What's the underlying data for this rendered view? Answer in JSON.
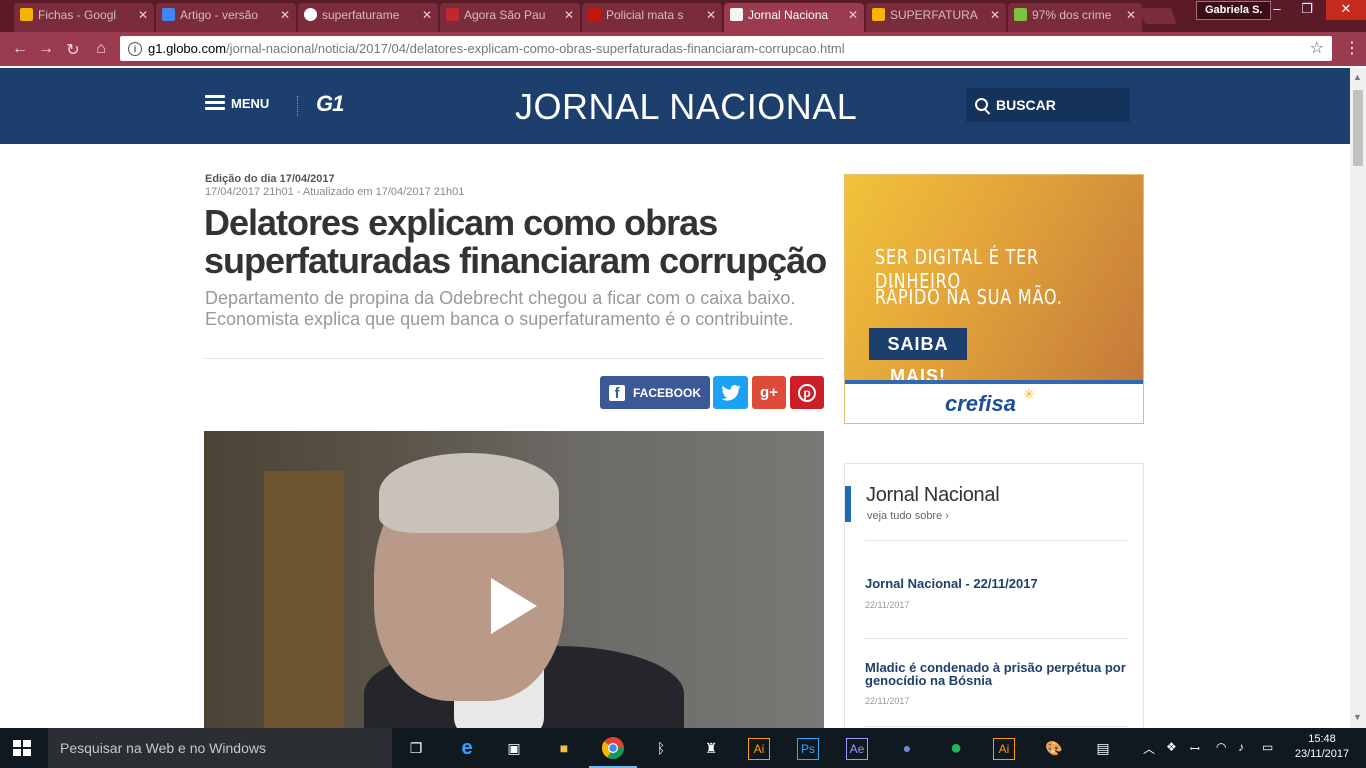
{
  "browser": {
    "tabs": [
      {
        "title": "Fichas - Googl",
        "favicon_color": "#f4b400"
      },
      {
        "title": "Artigo - versão",
        "favicon_color": "#4285f4"
      },
      {
        "title": "superfaturame",
        "favicon_color": "#ffffff"
      },
      {
        "title": "Agora São Pau",
        "favicon_color": "#c0282d"
      },
      {
        "title": "Policial mata s",
        "favicon_color": "#c4170c"
      },
      {
        "title": "Jornal Naciona",
        "favicon_color": "#f5f5f5"
      },
      {
        "title": "SUPERFATURA",
        "favicon_color": "#f4b400"
      },
      {
        "title": "97% dos crime",
        "favicon_color": "#7cc242"
      }
    ],
    "user": "Gabriela S.",
    "url_host": "g1.globo.com",
    "url_path": "/jornal-nacional/noticia/2017/04/delatores-explicam-como-obras-superfaturadas-financiaram-corrupcao.html"
  },
  "site": {
    "menu_label": "MENU",
    "logo": "G1",
    "title": "JORNAL NACIONAL",
    "search_label": "BUSCAR",
    "brand_color": "#1d3f6e"
  },
  "article": {
    "edition_prefix": "Edição do dia",
    "edition_date": "17/04/2017",
    "dates": "17/04/2017 21h01 - Atualizado em 17/04/2017 21h01",
    "headline": "Delatores explicam como obras superfaturadas financiaram corrupção",
    "subhead": "Departamento de propina da Odebrecht chegou a ficar com o caixa baixo. Economista explica que quem banca o superfaturamento é o contribuinte.",
    "share": {
      "facebook": "FACEBOOK",
      "twitter_icon": "twitter-icon",
      "gplus": "g+",
      "pinterest_icon": "pinterest-icon"
    }
  },
  "ad": {
    "line1": "SER DIGITAL É TER DINHEIRO",
    "line2": "RÁPIDO NA SUA MÃO.",
    "button": "SAIBA MAIS!",
    "brand": "crefisa"
  },
  "widget": {
    "title": "Jornal Nacional",
    "more": "veja tudo sobre ›",
    "items": [
      {
        "title": "Jornal Nacional - 22/11/2017",
        "date": "22/11/2017"
      },
      {
        "title": "Mladic é condenado à prisão perpétua por genocídio na Bósnia",
        "date": "22/11/2017"
      }
    ]
  },
  "taskbar": {
    "search_placeholder": "Pesquisar na Web e no Windows",
    "time": "15:48",
    "date": "23/11/2017"
  }
}
